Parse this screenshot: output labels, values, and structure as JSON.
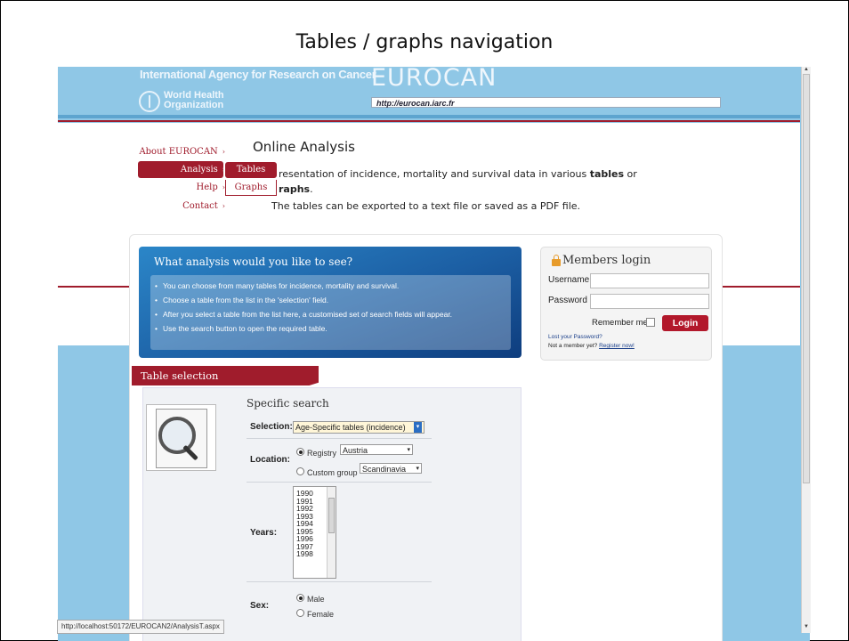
{
  "slide": {
    "title": "Tables / graphs navigation"
  },
  "header": {
    "agency": "International Agency for Research on Cancer",
    "who_line1": "World Health",
    "who_line2": "Organization",
    "site_title": "EUROCAN",
    "url": "http://eurocan.iarc.fr"
  },
  "sidemenu": {
    "items": [
      {
        "label": "About EUROCAN"
      },
      {
        "label": "Analysis"
      },
      {
        "label": "Help"
      },
      {
        "label": "Contact"
      }
    ],
    "arrow": "›",
    "submenu": [
      {
        "label": "Tables"
      },
      {
        "label": "Graphs"
      }
    ]
  },
  "online_analysis": {
    "title": "Online Analysis",
    "line1_prefix": "resentation of incidence, mortality and survival data in various ",
    "line1_bold": "tables",
    "line1_suffix": " or",
    "line2_bold": "raphs",
    "line2_suffix": ".",
    "line3": "The tables can be exported to a text file or saved as a PDF file."
  },
  "what_analysis": {
    "title": "What analysis would you like to see?",
    "bullets": [
      "You can choose from many tables for incidence, mortality and survival.",
      "Choose a table from the list in the 'selection' field.",
      "After you select a table from the list here, a customised set of search fields will appear.",
      "Use the search button to open the required table."
    ]
  },
  "login": {
    "title": "Members login",
    "username_label": "Username",
    "password_label": "Password",
    "remember_label": "Remember me",
    "button": "Login",
    "lost_password": "Lost your Password?",
    "not_member": "Not a member yet?",
    "register": "Register now!",
    "accent": "#b2182b"
  },
  "table_selection": {
    "tab_label": "Table selection",
    "heading": "Specific search",
    "selection_label": "Selection:",
    "selection_value": "Age-Specific tables (incidence)",
    "location_label": "Location:",
    "registry_label": "Registry",
    "registry_value": "Austria",
    "custom_group_label": "Custom group",
    "custom_group_value": "Scandinavia",
    "years_label": "Years:",
    "years": [
      "1990",
      "1991",
      "1992",
      "1993",
      "1994",
      "1995",
      "1996",
      "1997",
      "1998"
    ],
    "sex_label": "Sex:",
    "sex_options": [
      "Male",
      "Female"
    ],
    "sex_selected": "Male"
  },
  "status_bar": {
    "text": "http://localhost:50172/EUROCAN2/AnalysisT.aspx"
  },
  "colors": {
    "brand_red": "#a01c2c",
    "sky_blue": "#8fc7e6",
    "dark_blue": "#1c5fa4"
  }
}
